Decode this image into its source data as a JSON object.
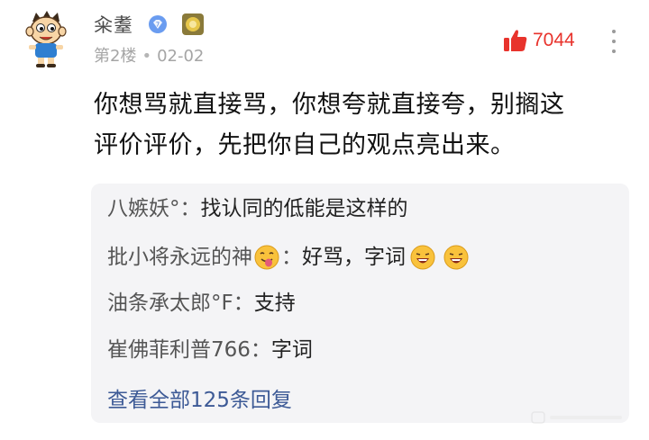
{
  "post": {
    "username": "籴耋",
    "floor": "第2楼",
    "date": "02-02",
    "likes": "7044",
    "comment_lines": [
      "你想骂就直接骂，你想夸就直接夸，别搁这",
      "评价评价，先把你自己的观点亮出来。"
    ]
  },
  "replies": [
    {
      "author": "八嫉妖°",
      "sep": "：",
      "text": "找认同的低能是这样的"
    },
    {
      "author": "批小将永远的神",
      "sep": "：",
      "text": "好骂，字词"
    },
    {
      "author": "油条承太郎°F",
      "sep": "：",
      "text": "支持"
    },
    {
      "author": "崔佛菲利普766",
      "sep": "：",
      "text": "字词"
    }
  ],
  "view_all": "查看全部125条回复",
  "colors": {
    "like_red": "#e8332c",
    "link_blue": "#3d5a96",
    "reply_bg": "#f4f4f6"
  },
  "icons": {
    "avatar": "cartoon-boy-avatar",
    "verified": "blue-diamond-verified-icon",
    "badge": "yellow-level-badge-icon",
    "like": "red-thumbs-up-icon",
    "more": "vertical-ellipsis-icon",
    "emoji_tongue": "tongue-out-emoji",
    "emoji_grin": "grinning-emoji"
  }
}
